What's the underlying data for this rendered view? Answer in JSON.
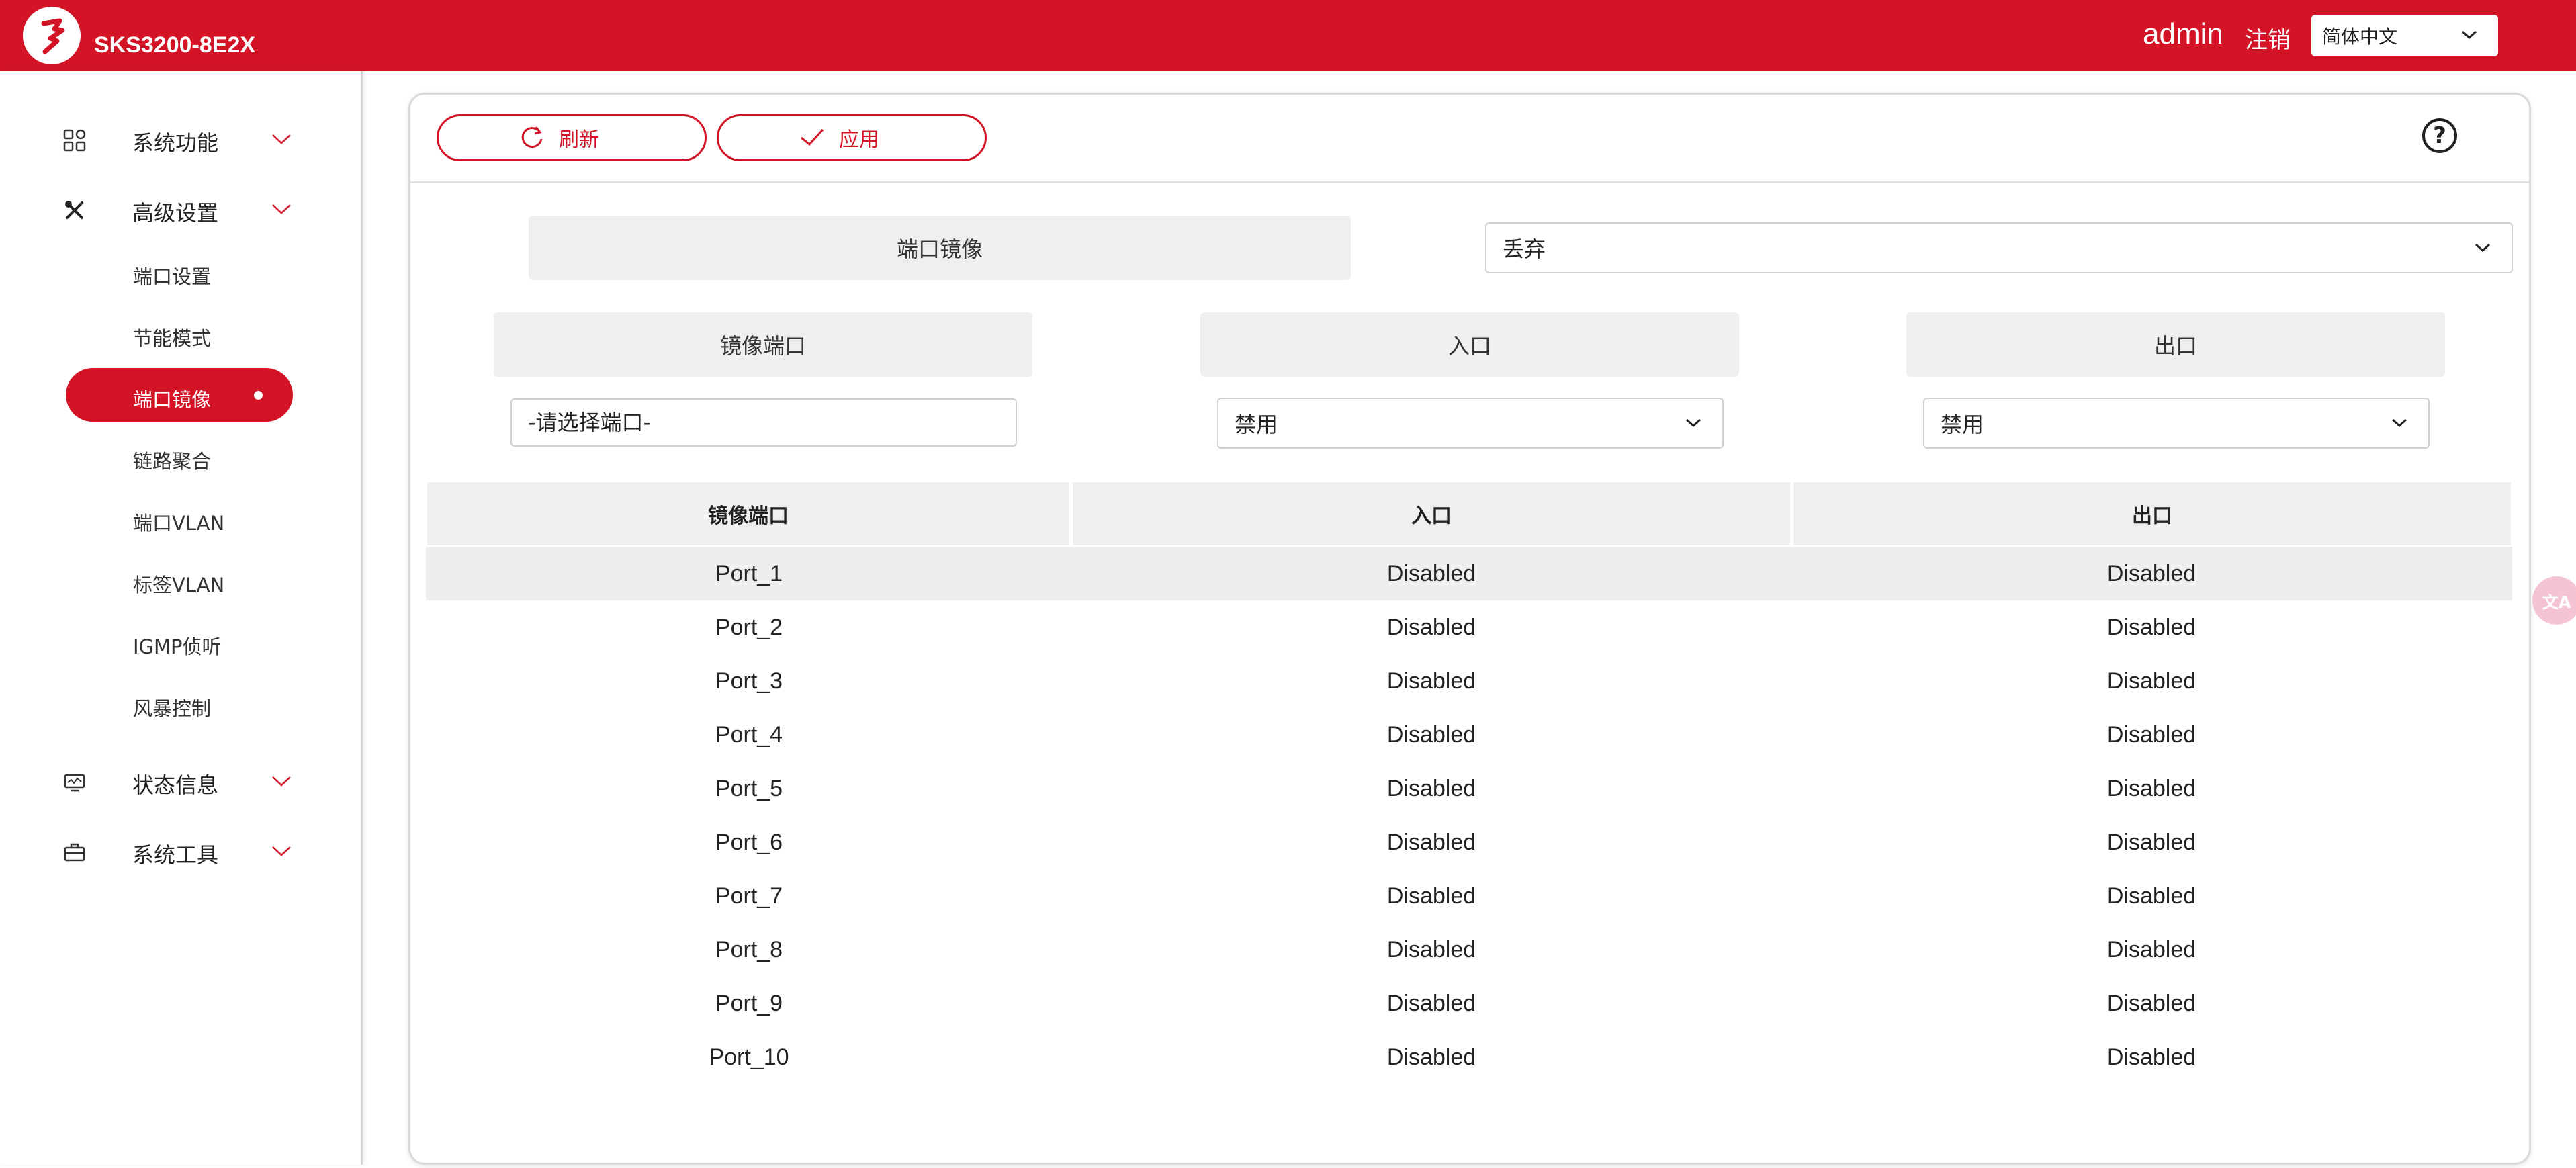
{
  "header": {
    "title": "SKS3200-8E2X",
    "user": "admin",
    "logout": "注销",
    "language": "简体中文"
  },
  "sidebar": {
    "groups": [
      {
        "label": "系统功能",
        "icon": "grid-icon"
      },
      {
        "label": "高级设置",
        "icon": "tools-icon"
      },
      {
        "label": "状态信息",
        "icon": "monitor-icon"
      },
      {
        "label": "系统工具",
        "icon": "toolbox-icon"
      }
    ],
    "items": [
      {
        "label": "端口设置"
      },
      {
        "label": "节能模式"
      },
      {
        "label": "端口镜像",
        "active": true
      },
      {
        "label": "链路聚合"
      },
      {
        "label": "端口VLAN"
      },
      {
        "label": "标签VLAN"
      },
      {
        "label": "IGMP侦听"
      },
      {
        "label": "风暴控制"
      }
    ]
  },
  "toolbar": {
    "refresh": "刷新",
    "apply": "应用",
    "help": "?"
  },
  "form": {
    "mirror_label": "端口镜像",
    "mirror_value": "丢弃",
    "mirror_port_label": "镜像端口",
    "ingress_label": "入口",
    "egress_label": "出口",
    "mirror_port_placeholder": "-请选择端口-",
    "ingress_value": "禁用",
    "egress_value": "禁用"
  },
  "table": {
    "headers": [
      "镜像端口",
      "入口",
      "出口"
    ],
    "rows": [
      [
        "Port_1",
        "Disabled",
        "Disabled"
      ],
      [
        "Port_2",
        "Disabled",
        "Disabled"
      ],
      [
        "Port_3",
        "Disabled",
        "Disabled"
      ],
      [
        "Port_4",
        "Disabled",
        "Disabled"
      ],
      [
        "Port_5",
        "Disabled",
        "Disabled"
      ],
      [
        "Port_6",
        "Disabled",
        "Disabled"
      ],
      [
        "Port_7",
        "Disabled",
        "Disabled"
      ],
      [
        "Port_8",
        "Disabled",
        "Disabled"
      ],
      [
        "Port_9",
        "Disabled",
        "Disabled"
      ],
      [
        "Port_10",
        "Disabled",
        "Disabled"
      ]
    ]
  },
  "colors": {
    "brand": "#d21426",
    "label_bg": "#efefef"
  }
}
